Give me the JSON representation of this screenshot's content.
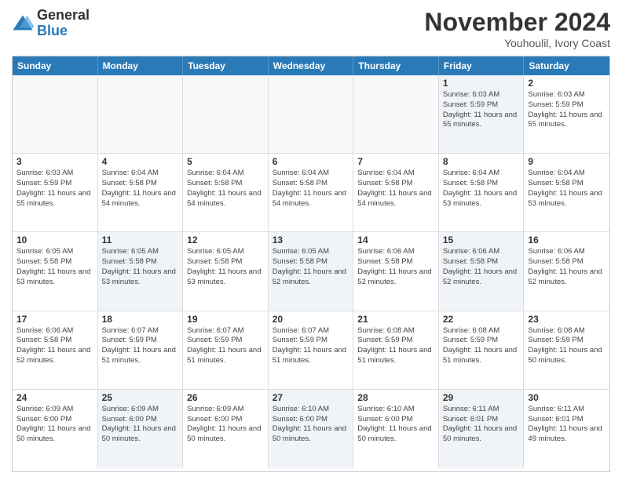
{
  "header": {
    "logo_general": "General",
    "logo_blue": "Blue",
    "month_title": "November 2024",
    "location": "Youhoulil, Ivory Coast"
  },
  "days_of_week": [
    "Sunday",
    "Monday",
    "Tuesday",
    "Wednesday",
    "Thursday",
    "Friday",
    "Saturday"
  ],
  "weeks": [
    [
      {
        "day": "",
        "info": ""
      },
      {
        "day": "",
        "info": ""
      },
      {
        "day": "",
        "info": ""
      },
      {
        "day": "",
        "info": ""
      },
      {
        "day": "",
        "info": ""
      },
      {
        "day": "1",
        "info": "Sunrise: 6:03 AM\nSunset: 5:59 PM\nDaylight: 11 hours and 55 minutes."
      },
      {
        "day": "2",
        "info": "Sunrise: 6:03 AM\nSunset: 5:59 PM\nDaylight: 11 hours and 55 minutes."
      }
    ],
    [
      {
        "day": "3",
        "info": "Sunrise: 6:03 AM\nSunset: 5:59 PM\nDaylight: 11 hours and 55 minutes."
      },
      {
        "day": "4",
        "info": "Sunrise: 6:04 AM\nSunset: 5:58 PM\nDaylight: 11 hours and 54 minutes."
      },
      {
        "day": "5",
        "info": "Sunrise: 6:04 AM\nSunset: 5:58 PM\nDaylight: 11 hours and 54 minutes."
      },
      {
        "day": "6",
        "info": "Sunrise: 6:04 AM\nSunset: 5:58 PM\nDaylight: 11 hours and 54 minutes."
      },
      {
        "day": "7",
        "info": "Sunrise: 6:04 AM\nSunset: 5:58 PM\nDaylight: 11 hours and 54 minutes."
      },
      {
        "day": "8",
        "info": "Sunrise: 6:04 AM\nSunset: 5:58 PM\nDaylight: 11 hours and 53 minutes."
      },
      {
        "day": "9",
        "info": "Sunrise: 6:04 AM\nSunset: 5:58 PM\nDaylight: 11 hours and 53 minutes."
      }
    ],
    [
      {
        "day": "10",
        "info": "Sunrise: 6:05 AM\nSunset: 5:58 PM\nDaylight: 11 hours and 53 minutes."
      },
      {
        "day": "11",
        "info": "Sunrise: 6:05 AM\nSunset: 5:58 PM\nDaylight: 11 hours and 53 minutes."
      },
      {
        "day": "12",
        "info": "Sunrise: 6:05 AM\nSunset: 5:58 PM\nDaylight: 11 hours and 53 minutes."
      },
      {
        "day": "13",
        "info": "Sunrise: 6:05 AM\nSunset: 5:58 PM\nDaylight: 11 hours and 52 minutes."
      },
      {
        "day": "14",
        "info": "Sunrise: 6:06 AM\nSunset: 5:58 PM\nDaylight: 11 hours and 52 minutes."
      },
      {
        "day": "15",
        "info": "Sunrise: 6:06 AM\nSunset: 5:58 PM\nDaylight: 11 hours and 52 minutes."
      },
      {
        "day": "16",
        "info": "Sunrise: 6:06 AM\nSunset: 5:58 PM\nDaylight: 11 hours and 52 minutes."
      }
    ],
    [
      {
        "day": "17",
        "info": "Sunrise: 6:06 AM\nSunset: 5:58 PM\nDaylight: 11 hours and 52 minutes."
      },
      {
        "day": "18",
        "info": "Sunrise: 6:07 AM\nSunset: 5:59 PM\nDaylight: 11 hours and 51 minutes."
      },
      {
        "day": "19",
        "info": "Sunrise: 6:07 AM\nSunset: 5:59 PM\nDaylight: 11 hours and 51 minutes."
      },
      {
        "day": "20",
        "info": "Sunrise: 6:07 AM\nSunset: 5:59 PM\nDaylight: 11 hours and 51 minutes."
      },
      {
        "day": "21",
        "info": "Sunrise: 6:08 AM\nSunset: 5:59 PM\nDaylight: 11 hours and 51 minutes."
      },
      {
        "day": "22",
        "info": "Sunrise: 6:08 AM\nSunset: 5:59 PM\nDaylight: 11 hours and 51 minutes."
      },
      {
        "day": "23",
        "info": "Sunrise: 6:08 AM\nSunset: 5:59 PM\nDaylight: 11 hours and 50 minutes."
      }
    ],
    [
      {
        "day": "24",
        "info": "Sunrise: 6:09 AM\nSunset: 6:00 PM\nDaylight: 11 hours and 50 minutes."
      },
      {
        "day": "25",
        "info": "Sunrise: 6:09 AM\nSunset: 6:00 PM\nDaylight: 11 hours and 50 minutes."
      },
      {
        "day": "26",
        "info": "Sunrise: 6:09 AM\nSunset: 6:00 PM\nDaylight: 11 hours and 50 minutes."
      },
      {
        "day": "27",
        "info": "Sunrise: 6:10 AM\nSunset: 6:00 PM\nDaylight: 11 hours and 50 minutes."
      },
      {
        "day": "28",
        "info": "Sunrise: 6:10 AM\nSunset: 6:00 PM\nDaylight: 11 hours and 50 minutes."
      },
      {
        "day": "29",
        "info": "Sunrise: 6:11 AM\nSunset: 6:01 PM\nDaylight: 11 hours and 50 minutes."
      },
      {
        "day": "30",
        "info": "Sunrise: 6:11 AM\nSunset: 6:01 PM\nDaylight: 11 hours and 49 minutes."
      }
    ]
  ]
}
